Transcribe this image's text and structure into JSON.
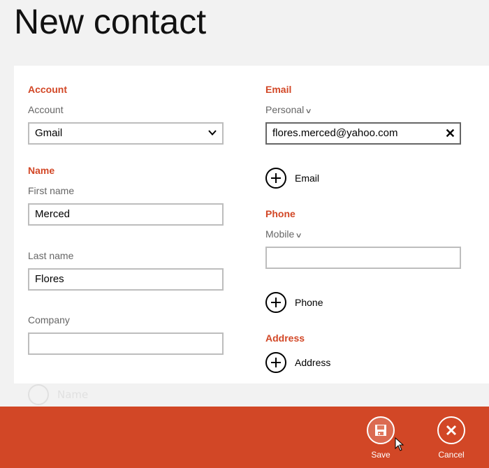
{
  "page": {
    "title": "New contact"
  },
  "colors": {
    "accent": "#d24726",
    "background": "#f2f2f2",
    "panel": "#ffffff"
  },
  "account": {
    "section": "Account",
    "label": "Account",
    "selected": "Gmail"
  },
  "name": {
    "section": "Name",
    "first_label": "First name",
    "first_value": "Merced",
    "last_label": "Last name",
    "last_value": "Flores",
    "company_label": "Company",
    "company_value": ""
  },
  "email": {
    "section": "Email",
    "type_label": "Personal",
    "value": "flores.merced@yahoo.com",
    "add_label": "Email"
  },
  "phone": {
    "section": "Phone",
    "type_label": "Mobile",
    "value": "",
    "add_label": "Phone"
  },
  "address": {
    "section": "Address",
    "add_label": "Address"
  },
  "ghost": {
    "add_label": "Name"
  },
  "appbar": {
    "save_label": "Save",
    "cancel_label": "Cancel"
  }
}
